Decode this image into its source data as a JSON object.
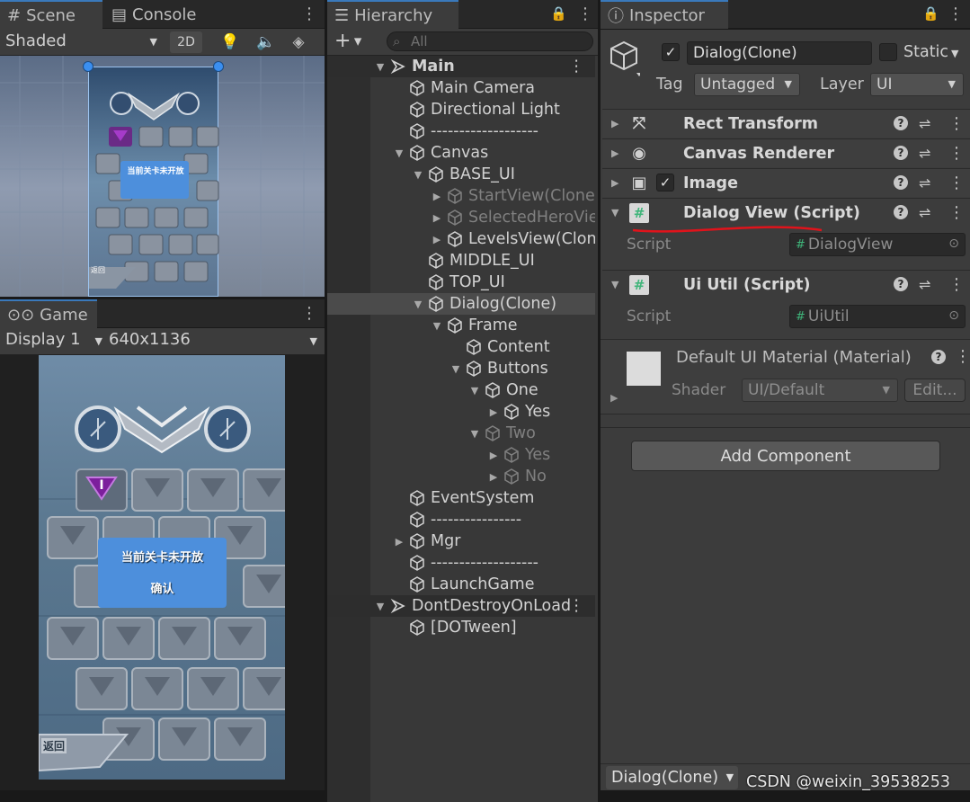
{
  "scene": {
    "tab_scene": "Scene",
    "tab_console": "Console",
    "shading_mode": "Shaded",
    "mode_2d": "2D",
    "preview_text_dialog": "当前关卡未开放",
    "preview_text_back": "返回"
  },
  "game": {
    "tab": "Game",
    "display": "Display 1",
    "resolution": "640x1136",
    "dialog_message": "当前关卡未开放",
    "dialog_confirm": "确认",
    "back_label": "返回",
    "level_badge": "I"
  },
  "hierarchy": {
    "tab": "Hierarchy",
    "search_placeholder": "All",
    "rows": [
      {
        "label": "Main",
        "depth": 0,
        "arrow": "down",
        "kind": "scene"
      },
      {
        "label": "Main Camera",
        "depth": 1,
        "arrow": ""
      },
      {
        "label": "Directional Light",
        "depth": 1,
        "arrow": ""
      },
      {
        "label": "-------------------",
        "depth": 1,
        "arrow": ""
      },
      {
        "label": "Canvas",
        "depth": 1,
        "arrow": "down"
      },
      {
        "label": "BASE_UI",
        "depth": 2,
        "arrow": "down"
      },
      {
        "label": "StartView(Clone)",
        "depth": 3,
        "arrow": "right",
        "dim": true
      },
      {
        "label": "SelectedHeroView",
        "depth": 3,
        "arrow": "right",
        "dim": true
      },
      {
        "label": "LevelsView(Clone)",
        "depth": 3,
        "arrow": "right"
      },
      {
        "label": "MIDDLE_UI",
        "depth": 2,
        "arrow": ""
      },
      {
        "label": "TOP_UI",
        "depth": 2,
        "arrow": ""
      },
      {
        "label": "Dialog(Clone)",
        "depth": 2,
        "arrow": "down",
        "selected": true
      },
      {
        "label": "Frame",
        "depth": 3,
        "arrow": "down"
      },
      {
        "label": "Content",
        "depth": 4,
        "arrow": ""
      },
      {
        "label": "Buttons",
        "depth": 4,
        "arrow": "down"
      },
      {
        "label": "One",
        "depth": 5,
        "arrow": "down"
      },
      {
        "label": "Yes",
        "depth": 6,
        "arrow": "right"
      },
      {
        "label": "Two",
        "depth": 5,
        "arrow": "down",
        "dim": true
      },
      {
        "label": "Yes",
        "depth": 6,
        "arrow": "right",
        "dim": true
      },
      {
        "label": "No",
        "depth": 6,
        "arrow": "right",
        "dim": true
      },
      {
        "label": "EventSystem",
        "depth": 1,
        "arrow": ""
      },
      {
        "label": "----------------",
        "depth": 1,
        "arrow": ""
      },
      {
        "label": "Mgr",
        "depth": 1,
        "arrow": "right"
      },
      {
        "label": "-------------------",
        "depth": 1,
        "arrow": ""
      },
      {
        "label": "LaunchGame",
        "depth": 1,
        "arrow": ""
      },
      {
        "label": "DontDestroyOnLoad",
        "depth": 0,
        "arrow": "down",
        "kind": "scene2"
      },
      {
        "label": "[DOTween]",
        "depth": 1,
        "arrow": ""
      }
    ]
  },
  "inspector": {
    "tab": "Inspector",
    "object_name": "Dialog(Clone)",
    "static_label": "Static",
    "tag_label": "Tag",
    "tag_value": "Untagged",
    "layer_label": "Layer",
    "layer_value": "UI",
    "components": [
      {
        "name": "Rect Transform",
        "icon": "rect-transform-icon"
      },
      {
        "name": "Canvas Renderer",
        "icon": "eye-icon"
      },
      {
        "name": "Image",
        "icon": "image-icon",
        "checkbox": true
      },
      {
        "name": "Dialog View (Script)",
        "icon": "script-icon",
        "expanded": true
      },
      {
        "name": "Ui Util (Script)",
        "icon": "script-icon",
        "expanded": true
      }
    ],
    "script_label": "Script",
    "dialogview_script": "DialogView",
    "uiutil_script": "UiUtil",
    "material_name": "Default UI Material (Material)",
    "shader_label": "Shader",
    "shader_value": "UI/Default",
    "edit_label": "Edit...",
    "add_component": "Add Component",
    "footer_selection": "Dialog(Clone)",
    "watermark": "CSDN @weixin_39538253"
  },
  "colors": {
    "accent": "#3a79bb",
    "annotation_red": "#e0131b",
    "script_green": "#3fb57a",
    "dialog_blue": "#4d8fdc"
  }
}
